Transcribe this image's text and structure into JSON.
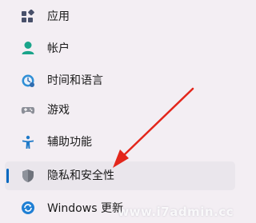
{
  "sidebar": {
    "items": [
      {
        "label": "应用",
        "icon": "apps-icon",
        "selected": false
      },
      {
        "label": "帐户",
        "icon": "account-icon",
        "selected": false
      },
      {
        "label": "时间和语言",
        "icon": "time-language-icon",
        "selected": false
      },
      {
        "label": "游戏",
        "icon": "gaming-icon",
        "selected": false
      },
      {
        "label": "辅助功能",
        "icon": "accessibility-icon",
        "selected": false
      },
      {
        "label": "隐私和安全性",
        "icon": "shield-icon",
        "selected": true
      },
      {
        "label": "Windows 更新",
        "icon": "windows-update-icon",
        "selected": false
      }
    ]
  },
  "annotation": {
    "arrow_color": "#e3261b",
    "points_to": "隐私和安全性"
  },
  "watermark": {
    "text": "www.i7admin.cc"
  },
  "colors": {
    "background": "#f3eef3",
    "selected_background": "#eae6ec",
    "accent": "#0067c0"
  }
}
